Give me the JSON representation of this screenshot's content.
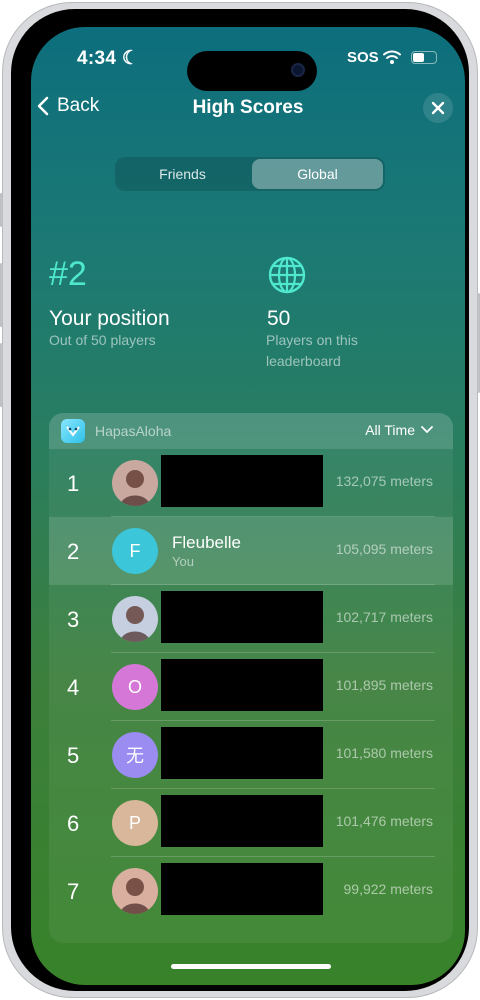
{
  "status_bar": {
    "time": "4:34",
    "carrier": "SOS"
  },
  "nav": {
    "back_label": "Back",
    "title": "High Scores"
  },
  "segments": [
    {
      "label": "Friends",
      "active": false
    },
    {
      "label": "Global",
      "active": true
    }
  ],
  "stats": {
    "rank": "#2",
    "rank_label": "Your position",
    "rank_sub": "Out of 50 players",
    "players": "50",
    "players_sub_line1": "Players on this",
    "players_sub_line2": "leaderboard"
  },
  "leaderboard": {
    "app_name": "HapasAloha",
    "time_filter": "All Time",
    "rows": [
      {
        "rank": "1",
        "name": "",
        "sub": "",
        "score": "132,075 meters",
        "avatar_letter": "",
        "avatar_color": "#c9a8a0",
        "redacted": true
      },
      {
        "rank": "2",
        "name": "Fleubelle",
        "sub": "You",
        "score": "105,095 meters",
        "avatar_letter": "F",
        "avatar_color": "#3cc6d9",
        "redacted": false
      },
      {
        "rank": "3",
        "name": "",
        "sub": "",
        "score": "102,717 meters",
        "avatar_letter": "",
        "avatar_color": "#c5cfe0",
        "redacted": true
      },
      {
        "rank": "4",
        "name": "",
        "sub": "",
        "score": "101,895 meters",
        "avatar_letter": "O",
        "avatar_color": "#d577d6",
        "redacted": true
      },
      {
        "rank": "5",
        "name": "",
        "sub": "",
        "score": "101,580 meters",
        "avatar_letter": "无",
        "avatar_color": "#9a8cf0",
        "redacted": true
      },
      {
        "rank": "6",
        "name": "",
        "sub": "",
        "score": "101,476 meters",
        "avatar_letter": "P",
        "avatar_color": "#d8b79a",
        "redacted": true
      },
      {
        "rank": "7",
        "name": "",
        "sub": "",
        "score": "99,922 meters",
        "avatar_letter": "",
        "avatar_color": "#d9b0a0",
        "redacted": true
      }
    ]
  }
}
